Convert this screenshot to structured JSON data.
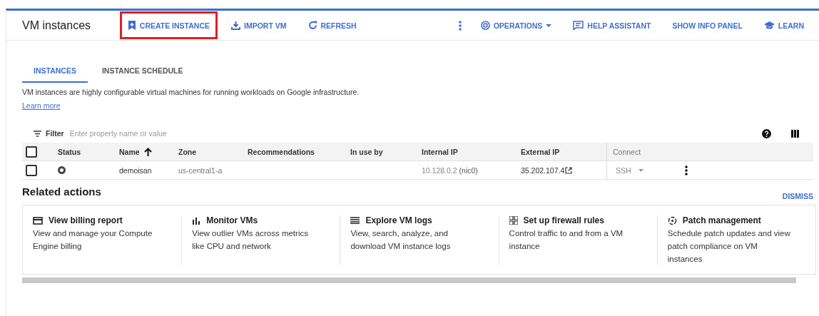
{
  "header": {
    "title": "VM instances",
    "actions": [
      {
        "kind": "button",
        "label": "CREATE INSTANCE",
        "highlighted": true
      },
      {
        "kind": "button",
        "label": "IMPORT VM",
        "highlighted": false
      },
      {
        "kind": "button",
        "label": "REFRESH",
        "highlighted": false
      },
      {
        "kind": "overflow"
      },
      {
        "kind": "menu",
        "label": "OPERATIONS",
        "highlighted": false
      },
      {
        "kind": "button",
        "label": "HELP ASSISTANT",
        "highlighted": false
      },
      {
        "kind": "plain",
        "label": "SHOW INFO PANEL",
        "highlighted": false
      },
      {
        "kind": "button",
        "label": "LEARN",
        "highlighted": false
      }
    ]
  },
  "tabs": [
    {
      "label": "INSTANCES",
      "selected": true
    },
    {
      "label": "INSTANCE SCHEDULE",
      "selected": false
    }
  ],
  "description": {
    "text": "VM instances are highly configurable virtual machines for running workloads on Google infrastructure.",
    "link": "Learn more"
  },
  "filter": {
    "label": "Filter",
    "placeholder": "Enter property name or value"
  },
  "table": {
    "select_all_checked": false,
    "columns": [
      {
        "label": "Status",
        "sorted": false
      },
      {
        "label": "Name",
        "sorted": true
      },
      {
        "label": "Zone",
        "sorted": false
      },
      {
        "label": "Recommendations",
        "sorted": false
      },
      {
        "label": "In use by",
        "sorted": false
      },
      {
        "label": "Internal IP",
        "sorted": false
      },
      {
        "label": "External IP",
        "sorted": false
      },
      {
        "label": "Connect",
        "sorted": false
      }
    ],
    "rows": [
      {
        "checked": false,
        "name": "demoisan",
        "zone": "us-central1-a",
        "internal_ip": "10.128.0.2",
        "nic": "(nic0)",
        "external_ip": "35.202.107.4",
        "connect": "SSH"
      }
    ]
  },
  "related": {
    "title": "Related actions",
    "dismiss": "DISMISS",
    "cards": [
      {
        "title": "View billing report",
        "text": "View and manage your Compute Engine billing"
      },
      {
        "title": "Monitor VMs",
        "text": "View outlier VMs across metrics like CPU and network"
      },
      {
        "title": "Explore VM logs",
        "text": "View, search, analyze, and download VM instance logs"
      },
      {
        "title": "Set up firewall rules",
        "text": "Control traffic to and from a VM instance"
      },
      {
        "title": "Patch management",
        "text": "Schedule patch updates and view patch compliance on VM instances"
      }
    ]
  }
}
